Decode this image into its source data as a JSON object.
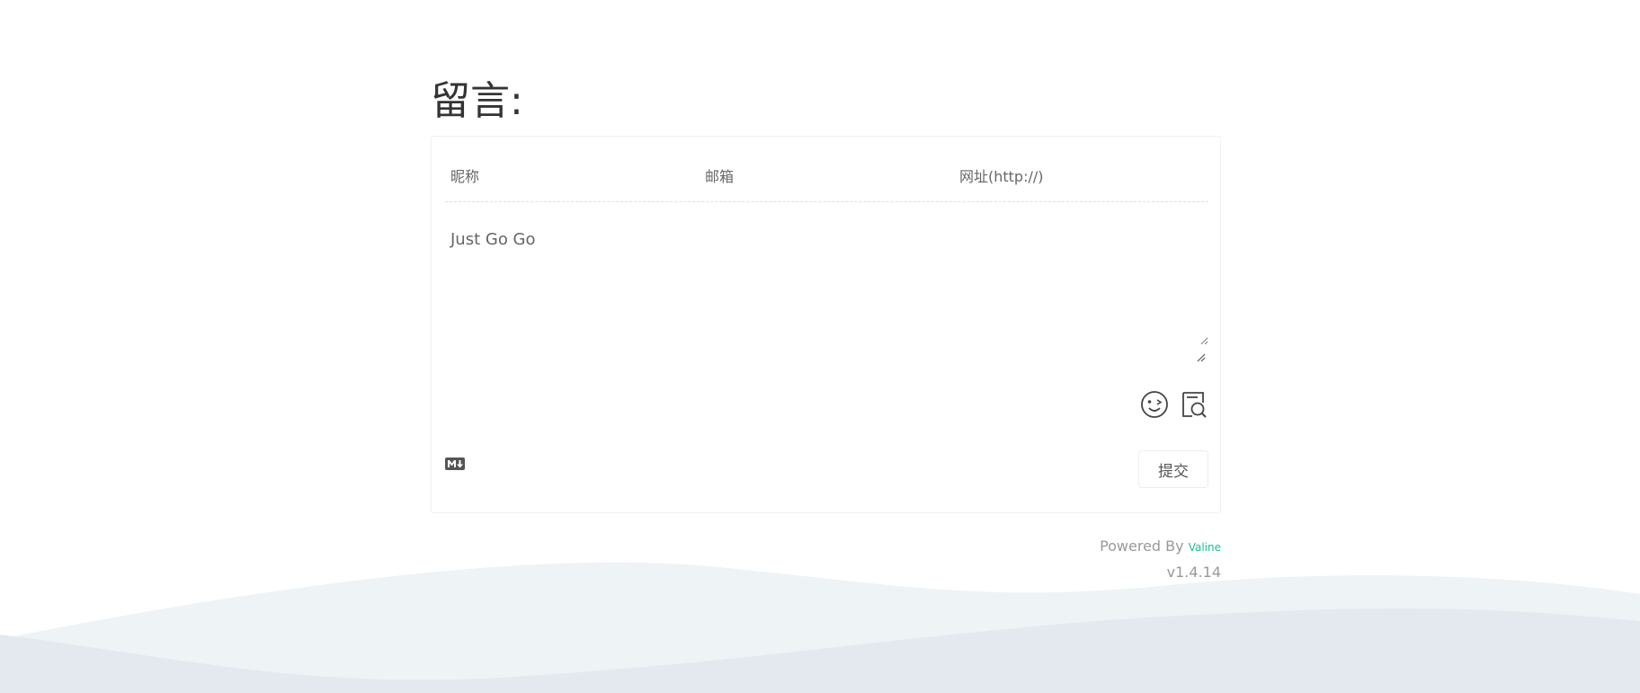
{
  "title": "留言:",
  "form": {
    "nick_placeholder": "昵称",
    "mail_placeholder": "邮箱",
    "link_placeholder": "网址(http://)",
    "content_placeholder": "Just Go Go",
    "submit_label": "提交"
  },
  "icons": {
    "emoji": "emoji-icon",
    "preview": "preview-icon",
    "markdown": "markdown-icon"
  },
  "footer": {
    "powered_by": "Powered By ",
    "brand": "Valine",
    "version": "v1.4.14"
  },
  "colors": {
    "brand": "#1abc9c",
    "wave_light": "#eef3f6",
    "wave_dark": "#e3e9ef"
  }
}
